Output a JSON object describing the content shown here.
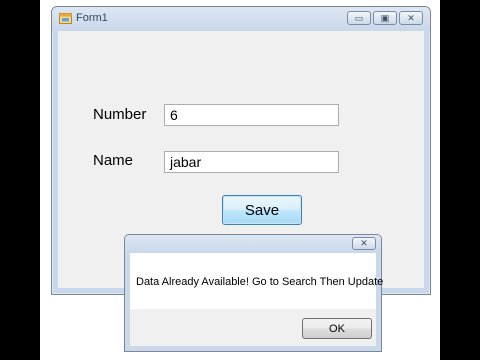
{
  "form": {
    "title": "Form1",
    "controls": {
      "minimize": "▭",
      "maximize": "▣",
      "close": "✕"
    },
    "number_label": "Number",
    "number_value": "6",
    "name_label": "Name",
    "name_value": "jabar",
    "save_label": "Save"
  },
  "message_box": {
    "close": "✕",
    "message": "Data Already Available! Go to Search Then Update",
    "ok_label": "OK"
  },
  "icons": {
    "app": "form-app-icon",
    "minimize": "minimize-icon",
    "maximize": "maximize-icon",
    "close": "close-icon"
  }
}
